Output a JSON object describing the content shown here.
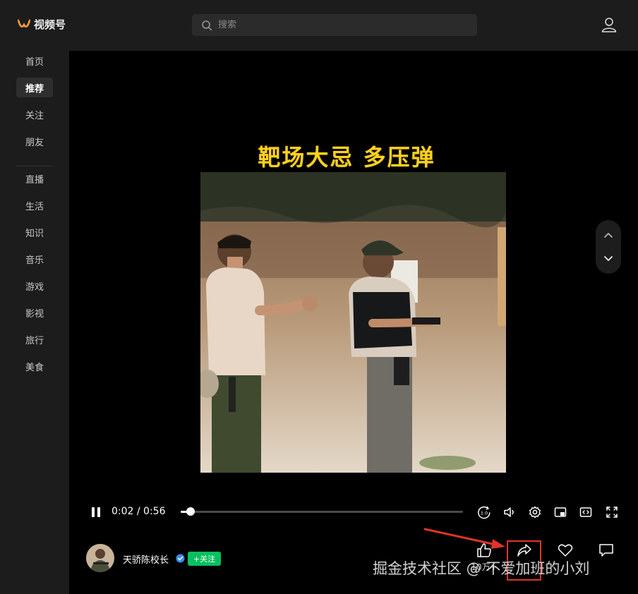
{
  "app": {
    "logo_text": "视频号",
    "brand_color": "#fa9d3b"
  },
  "search": {
    "placeholder": "搜索"
  },
  "sidebar": {
    "items": [
      {
        "label": "首页",
        "active": false
      },
      {
        "label": "推荐",
        "active": true
      },
      {
        "label": "关注",
        "active": false
      },
      {
        "label": "朋友",
        "active": false
      },
      {
        "label": "直播",
        "active": false
      },
      {
        "label": "生活",
        "active": false
      },
      {
        "label": "知识",
        "active": false
      },
      {
        "label": "音乐",
        "active": false
      },
      {
        "label": "游戏",
        "active": false
      },
      {
        "label": "影视",
        "active": false
      },
      {
        "label": "旅行",
        "active": false
      },
      {
        "label": "美食",
        "active": false
      }
    ]
  },
  "video": {
    "caption": "靶场大忌 多压弹",
    "current_time": "0:02",
    "duration": "0:56",
    "time_display": "0:02 / 0:56",
    "progress_fraction": 0.036,
    "speed_badge": "1.0"
  },
  "author": {
    "name": "天骄陈校长",
    "follow_label": "+关注",
    "follow_color": "#07c160"
  },
  "actions": [
    {
      "name": "like",
      "icon": "thumbs-up-icon",
      "count": "10万+"
    },
    {
      "name": "share",
      "icon": "share-arrow-icon",
      "count": ""
    },
    {
      "name": "favorite",
      "icon": "heart-icon",
      "count": ""
    },
    {
      "name": "comment",
      "icon": "comment-icon",
      "count": ""
    }
  ],
  "watermark": "掘金技术社区 @ 不爱加班的小刘",
  "annotation_color": "#e0342a"
}
